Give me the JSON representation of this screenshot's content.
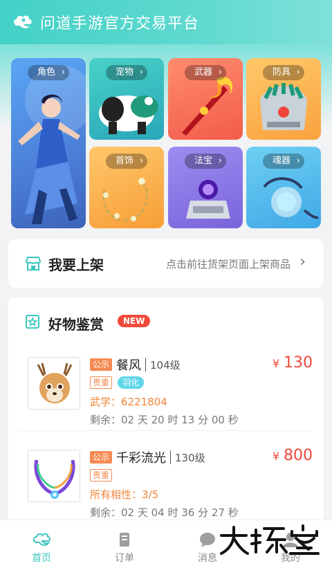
{
  "app": {
    "title": "问道手游官方交易平台",
    "accent": "#4fd4ca"
  },
  "categories": [
    {
      "label": "角色"
    },
    {
      "label": "宠物"
    },
    {
      "label": "武器"
    },
    {
      "label": "防具"
    },
    {
      "label": "首饰"
    },
    {
      "label": "法宝"
    },
    {
      "label": "魂器"
    }
  ],
  "shelf": {
    "label": "我要上架",
    "hint": "点击前往货架页面上架商品",
    "icon": "storefront-icon"
  },
  "goods": {
    "title": "好物鉴赏",
    "badge": "NEW",
    "icon": "star-icon",
    "items": [
      {
        "tag": "公示",
        "name": "餐风",
        "level": "104级",
        "price_symbol": "¥",
        "price": "130",
        "tags": [
          "贵重",
          "羽化"
        ],
        "attr": "武学：6221804",
        "remain": "剩余：02 天 20 时 13 分 00 秒"
      },
      {
        "tag": "公示",
        "name": "千彩流光",
        "level": "130级",
        "price_symbol": "¥",
        "price": "800",
        "tags": [
          "贵重"
        ],
        "attr": "所有相性：3/5",
        "remain": "剩余：02 天 04 时 36 分 27 秒"
      }
    ]
  },
  "tabs": [
    {
      "label": "首页",
      "icon": "home-icon",
      "active": true
    },
    {
      "label": "订单",
      "icon": "order-icon",
      "active": false
    },
    {
      "label": "消息",
      "icon": "message-icon",
      "active": false
    },
    {
      "label": "我的",
      "icon": "profile-icon",
      "active": false
    }
  ],
  "watermark": "大玩客"
}
